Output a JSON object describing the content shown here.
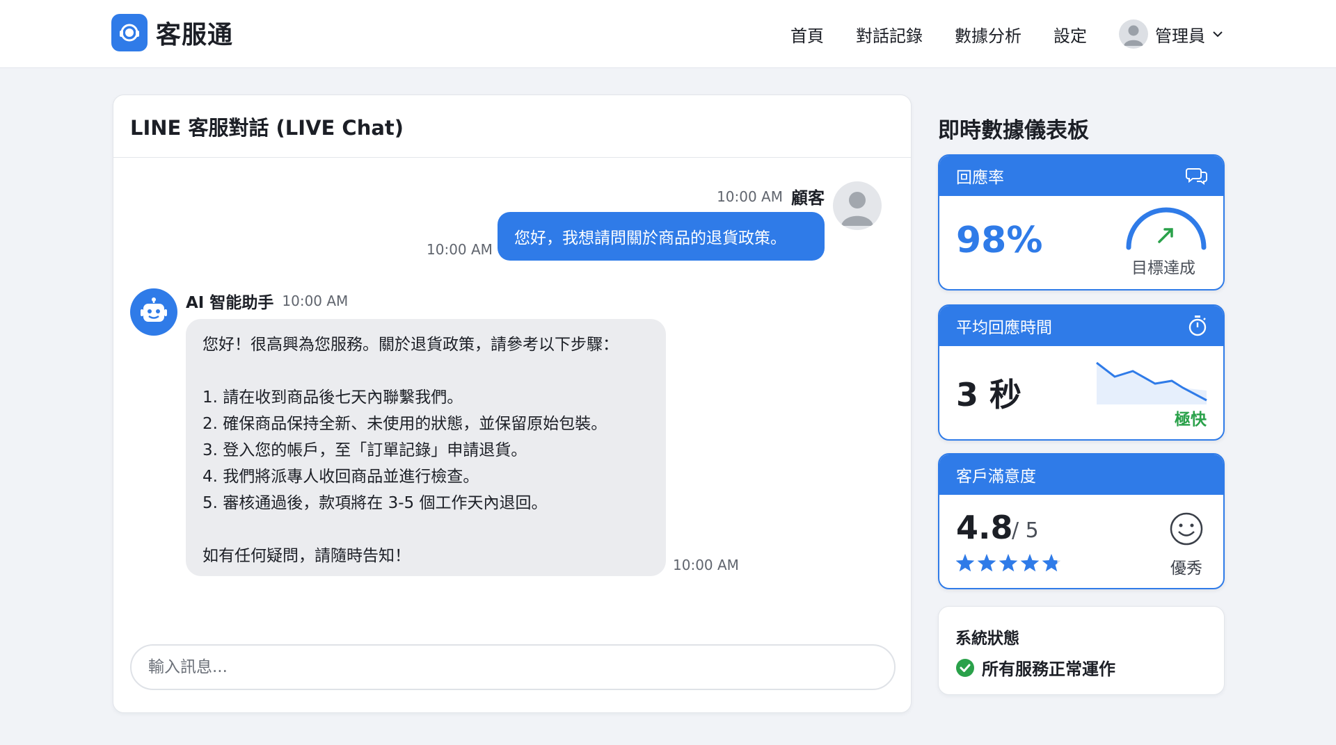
{
  "app": {
    "name": "客服通"
  },
  "nav": {
    "items": [
      "首頁",
      "對話記錄",
      "數據分析",
      "設定"
    ],
    "user": "管理員"
  },
  "chat": {
    "title": "LINE 客服對話 (LIVE Chat)",
    "customer": {
      "sender": "顧客",
      "time": "10:00 AM",
      "message": "您好，我想請問關於商品的退貨政策。",
      "message_time": "10:00 AM"
    },
    "bot": {
      "sender": "AI 智能助手",
      "time": "10:00 AM",
      "intro": "您好！很高興為您服務。關於退貨政策，請參考以下步驟：",
      "steps": [
        "1. 請在收到商品後七天內聯繫我們。",
        "2. 確保商品保持全新、未使用的狀態，並保留原始包裝。",
        "3. 登入您的帳戶，至「訂單記錄」申請退貨。",
        "4. 我們將派專人收回商品並進行檢查。",
        "5. 審核通過後，款項將在 3-5 個工作天內退回。"
      ],
      "closing": "如有任何疑問，請隨時告知！",
      "message_time": "10:00 AM"
    },
    "composer": {
      "placeholder": "輸入訊息..."
    }
  },
  "dashboard": {
    "title": "即時數據儀表板",
    "response_rate": {
      "label": "回應率",
      "value": "98%",
      "status": "目標達成",
      "icon": "chat-bubbles-icon"
    },
    "avg_response": {
      "label": "平均回應時間",
      "value": "3 秒",
      "status": "極快",
      "icon": "stopwatch-icon",
      "status_color": "#2aa14a"
    },
    "satisfaction": {
      "label": "客戶滿意度",
      "value": "4.8",
      "scale": "/ 5",
      "rating": 4.8,
      "status": "優秀",
      "icon": "smiley-icon"
    },
    "system": {
      "title": "系統狀態",
      "status": "所有服務正常運作",
      "status_color": "#2aa14a"
    }
  },
  "colors": {
    "accent": "#2f7be8",
    "success": "#2aa14a",
    "bubble_bot": "#ebecef"
  }
}
